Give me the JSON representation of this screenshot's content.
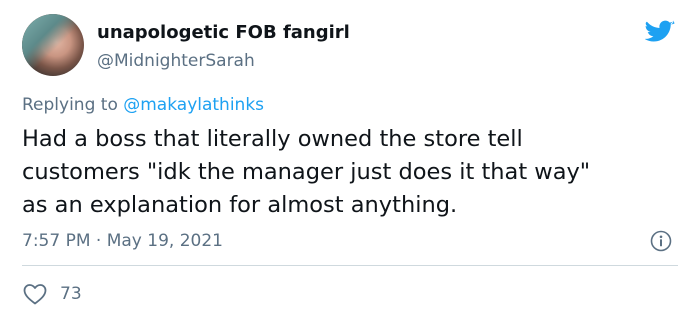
{
  "author": {
    "display_name": "unapologetic FOB fangirl",
    "handle": "@MidnighterSarah"
  },
  "icons": {
    "logo": "twitter-bird-icon",
    "info": "info-icon",
    "like": "heart-icon"
  },
  "colors": {
    "brand": "#1da1f2",
    "secondary_text": "#5b7083",
    "divider": "#cfd9de"
  },
  "reply": {
    "prefix": "Replying to",
    "mention": "@makaylathinks"
  },
  "tweet": {
    "lines": [
      "Had a boss that literally owned the store tell",
      "customers \"idk the manager just does it that way\"",
      "as an explanation for almost anything."
    ]
  },
  "meta": {
    "timestamp": "7:57 PM · May 19, 2021"
  },
  "stats": {
    "likes": "73"
  }
}
